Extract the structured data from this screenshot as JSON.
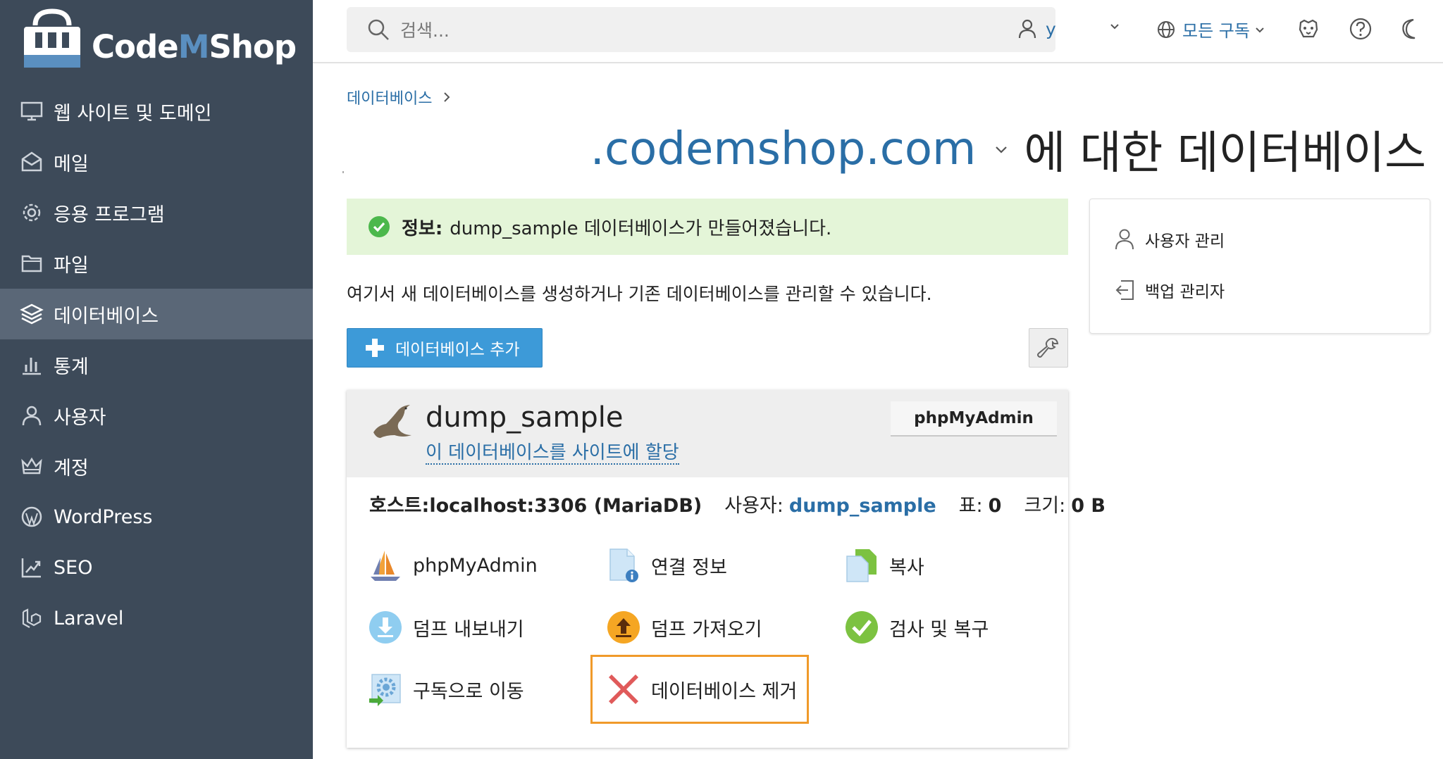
{
  "logo": {
    "text_before": "Code",
    "text_m": "M",
    "text_after": "Shop"
  },
  "sidebar": {
    "items": [
      {
        "label": "웹 사이트 및 도메인",
        "icon": "monitor-icon"
      },
      {
        "label": "메일",
        "icon": "mail-icon"
      },
      {
        "label": "응용 프로그램",
        "icon": "gear-icon"
      },
      {
        "label": "파일",
        "icon": "folder-icon"
      },
      {
        "label": "데이터베이스",
        "icon": "layers-icon",
        "active": true
      },
      {
        "label": "통계",
        "icon": "chart-icon"
      },
      {
        "label": "사용자",
        "icon": "user-icon"
      },
      {
        "label": "계정",
        "icon": "crown-icon"
      },
      {
        "label": "WordPress",
        "icon": "wordpress-icon"
      },
      {
        "label": "SEO",
        "icon": "seo-icon"
      },
      {
        "label": "Laravel",
        "icon": "laravel-icon"
      }
    ]
  },
  "header": {
    "search_placeholder": "검색...",
    "user": "y",
    "subscription": "모든 구독"
  },
  "breadcrumb": {
    "item": "데이터베이스"
  },
  "page": {
    "title_domain": ".codemshop.com",
    "title_suffix": "에 대한 데이터베이스"
  },
  "alert": {
    "label": "정보:",
    "message": "dump_sample 데이터베이스가 만들어졌습니다."
  },
  "intro": "여기서 새 데이터베이스를 생성하거나 기존 데이터베이스를 관리할 수 있습니다.",
  "toolbar": {
    "add_label": "데이터베이스 추가"
  },
  "side_panel": {
    "items": [
      {
        "label": "사용자 관리"
      },
      {
        "label": "백업 관리자"
      }
    ]
  },
  "database": {
    "name": "dump_sample",
    "assign_label": "이 데이터베이스를 사이트에 할당",
    "pma_button": "phpMyAdmin",
    "host": "호스트:localhost:3306 (MariaDB)",
    "user_label": "사용자:",
    "user_value": "dump_sample",
    "tables_label": "표:",
    "tables_value": "0",
    "size_label": "크기:",
    "size_value": "0 B"
  },
  "actions": {
    "phpmyadmin": "phpMyAdmin",
    "connection_info": "연결 정보",
    "copy": "복사",
    "export_dump": "덤프 내보내기",
    "import_dump": "덤프 가져오기",
    "check_repair": "검사 및 복구",
    "move_subscription": "구독으로 이동",
    "remove_database": "데이터베이스 제거"
  },
  "colors": {
    "sidebar_bg": "#3d4a59",
    "sidebar_active": "#5a6777",
    "link": "#2a6ea6",
    "primary_button": "#3d9ad8",
    "alert_bg": "#e4f5d8",
    "highlight": "#f09a2a"
  }
}
